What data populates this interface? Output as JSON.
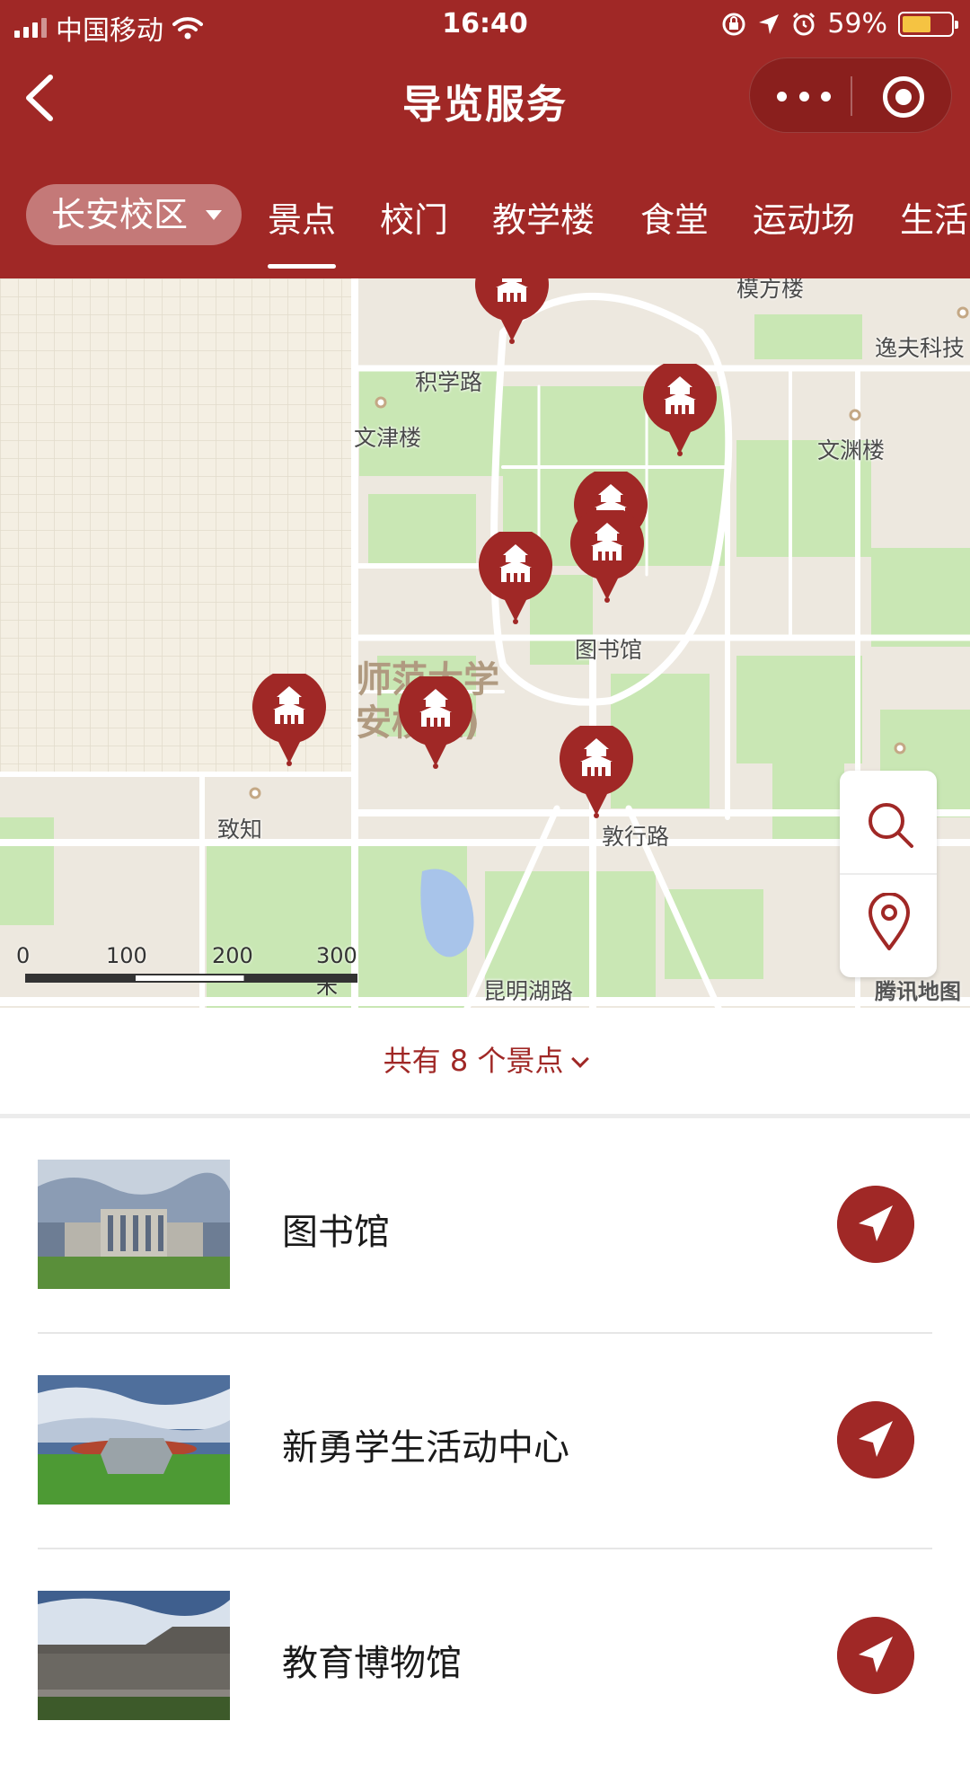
{
  "status_bar": {
    "carrier": "中国移动",
    "time": "16:40",
    "battery": "59%",
    "battery_level": 0.59
  },
  "navbar": {
    "title": "导览服务"
  },
  "filter": {
    "campus": "长安校区",
    "tabs": [
      "景点",
      "校门",
      "教学楼",
      "食堂",
      "运动场",
      "生活"
    ],
    "active_tab": "景点"
  },
  "map": {
    "labels": {
      "jixue_road": "积学路",
      "wenjin": "文津楼",
      "wenyuan": "文渊楼",
      "yifu": "逸夫科技",
      "yifang": "模方楼",
      "library": "图书馆",
      "campus_name_1": "师范大学",
      "campus_name_2": "安校区)",
      "zhizhi": "致知",
      "dunxing": "敦行路",
      "kunming": "昆明湖路"
    },
    "scale": [
      "0",
      "100",
      "200",
      "300 米"
    ],
    "provider": "腾讯地图"
  },
  "summary": {
    "text": "共有 8 个景点"
  },
  "spots": [
    {
      "name": "图书馆"
    },
    {
      "name": "新勇学生活动中心"
    },
    {
      "name": "教育博物馆"
    }
  ],
  "colors": {
    "brand": "#a02826",
    "map_green": "#c9e7b4",
    "map_base": "#ede8df"
  }
}
